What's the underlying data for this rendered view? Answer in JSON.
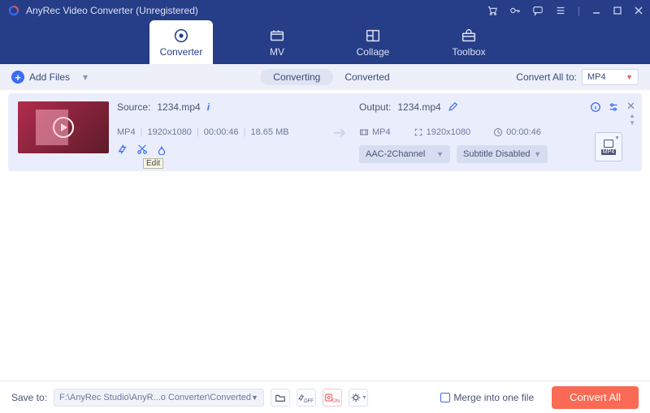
{
  "titlebar": {
    "title": "AnyRec Video Converter (Unregistered)"
  },
  "modules": {
    "converter": "Converter",
    "mv": "MV",
    "collage": "Collage",
    "toolbox": "Toolbox"
  },
  "subbar": {
    "add_files": "Add Files",
    "converting": "Converting",
    "converted": "Converted",
    "convert_all_to": "Convert All to:",
    "target_format": "MP4"
  },
  "item": {
    "source_label": "Source:",
    "source_name": "1234.mp4",
    "format": "MP4",
    "resolution": "1920x1080",
    "duration": "00:00:46",
    "size": "18.65 MB",
    "output_label": "Output:",
    "output_name": "1234.mp4",
    "out_format": "MP4",
    "out_resolution": "1920x1080",
    "out_duration": "00:00:46",
    "audio_dropdown": "AAC-2Channel",
    "subtitle_dropdown": "Subtitle Disabled",
    "format_badge": "MP4",
    "tooltip": "Edit"
  },
  "bottombar": {
    "save_to": "Save to:",
    "path": "F:\\AnyRec Studio\\AnyR...o Converter\\Converted",
    "merge": "Merge into one file",
    "convert_all": "Convert All"
  },
  "colors": {
    "brand": "#263d87",
    "accent_blue": "#3a6cf4",
    "accent_red": "#fa6a55"
  }
}
